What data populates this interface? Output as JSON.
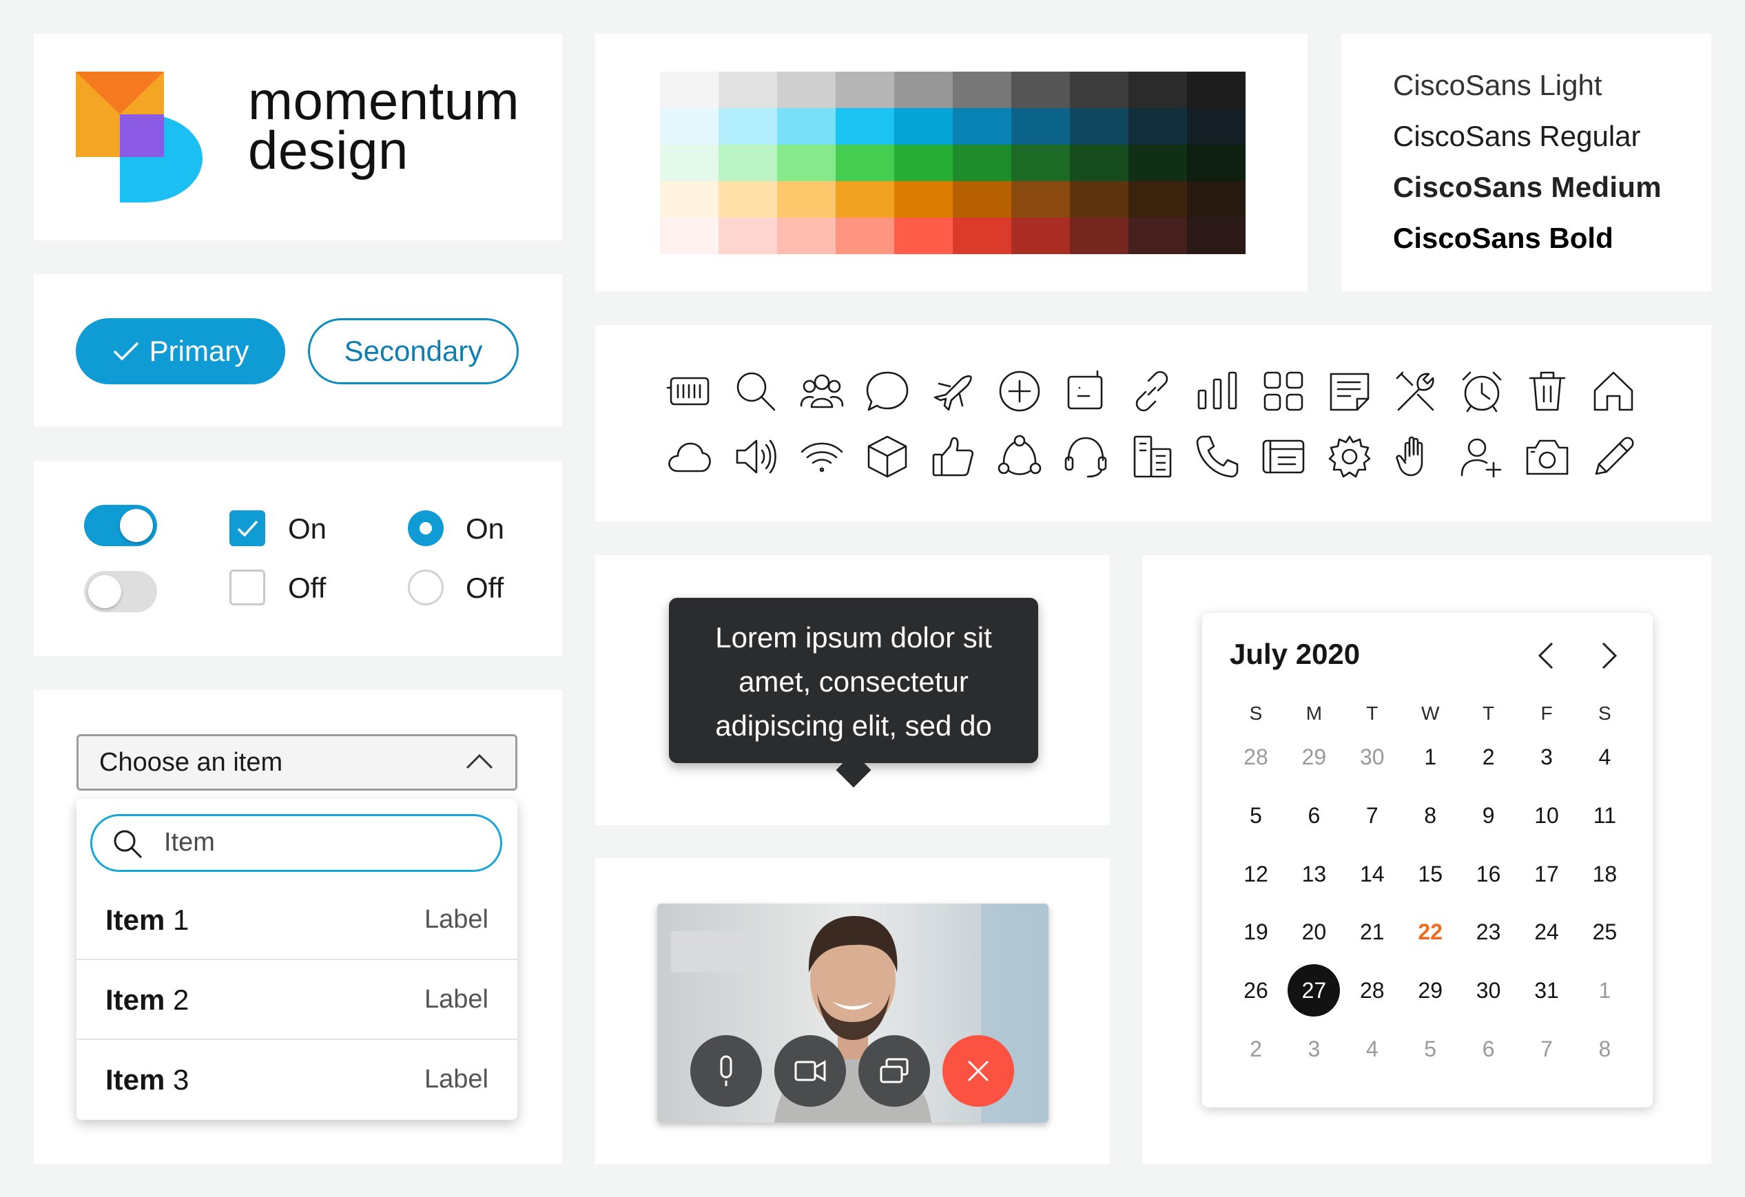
{
  "brand": {
    "line1": "momentum",
    "line2": "design"
  },
  "buttons": {
    "primary": "Primary",
    "secondary": "Secondary"
  },
  "controls": {
    "checkbox_on": "On",
    "checkbox_off": "Off",
    "radio_on": "On",
    "radio_off": "Off"
  },
  "palette": {
    "rows": [
      [
        "#f4f4f4",
        "#e2e2e2",
        "#cfcfcf",
        "#b5b5b5",
        "#979797",
        "#777777",
        "#555555",
        "#3c3c3c",
        "#2b2b2b",
        "#1c1c1c"
      ],
      [
        "#e4f8fd",
        "#b2eefc",
        "#79e0fa",
        "#1bc3f3",
        "#06a3d6",
        "#0882b2",
        "#0c6389",
        "#0f475f",
        "#112e3b",
        "#131f25"
      ],
      [
        "#e5f9ea",
        "#bbf5c6",
        "#86ea8d",
        "#45cd52",
        "#25ad34",
        "#1e8c2b",
        "#1c6a25",
        "#164b1d",
        "#102f14",
        "#0d1f10"
      ],
      [
        "#fff4e0",
        "#ffe1a9",
        "#fdc86b",
        "#f2a223",
        "#dd7e03",
        "#b66002",
        "#8a4a0f",
        "#5d330d",
        "#3a220c",
        "#251910"
      ],
      [
        "#fff2f0",
        "#ffd6cf",
        "#ffbdb0",
        "#ff9480",
        "#ff5c4a",
        "#db3b2b",
        "#a92d23",
        "#75261f",
        "#46201d",
        "#2b1918"
      ]
    ]
  },
  "fonts": [
    "CiscoSans Light",
    "CiscoSans Regular",
    "CiscoSans Medium",
    "CiscoSans Bold"
  ],
  "icons": {
    "row1": [
      "keyboard-icon",
      "search-icon",
      "people-icon",
      "chat-icon",
      "airplane-icon",
      "plus-circle-icon",
      "whiteboard-icon",
      "link-icon",
      "bar-chart-icon",
      "apps-icon",
      "notes-icon",
      "tools-icon",
      "alarm-icon",
      "trash-icon",
      "home-icon"
    ],
    "row2": [
      "cloud-icon",
      "speaker-icon",
      "wifi-icon",
      "cube-icon",
      "thumbs-up-icon",
      "share-icon",
      "headset-icon",
      "building-icon",
      "phone-icon",
      "calendar-panel-icon",
      "settings-icon",
      "raise-hand-icon",
      "add-user-icon",
      "camera-icon",
      "pencil-icon"
    ]
  },
  "dropdown": {
    "selected": "Choose an item",
    "search_placeholder": "Item",
    "items": [
      {
        "bold": "Item",
        "num": " 1",
        "label": "Label"
      },
      {
        "bold": "Item",
        "num": " 2",
        "label": "Label"
      },
      {
        "bold": "Item",
        "num": " 3",
        "label": "Label"
      }
    ]
  },
  "tooltip": {
    "lines": [
      "Lorem ipsum dolor sit",
      "amet, consectetur",
      "adipiscing elit, sed do"
    ]
  },
  "calendar": {
    "title": "July 2020",
    "dow": [
      "S",
      "M",
      "T",
      "W",
      "T",
      "F",
      "S"
    ],
    "weeks": [
      [
        "28",
        "29",
        "30",
        "1",
        "2",
        "3",
        "4"
      ],
      [
        "5",
        "6",
        "7",
        "8",
        "9",
        "10",
        "11"
      ],
      [
        "12",
        "13",
        "14",
        "15",
        "16",
        "17",
        "18"
      ],
      [
        "19",
        "20",
        "21",
        "22",
        "23",
        "24",
        "25"
      ],
      [
        "26",
        "27",
        "28",
        "29",
        "30",
        "31",
        "1"
      ],
      [
        "2",
        "3",
        "4",
        "5",
        "6",
        "7",
        "8"
      ]
    ],
    "today": "22",
    "selected": "27",
    "accent": "#f26b1d"
  },
  "colors": {
    "primary": "#0f9bd3",
    "danger": "#fc5242",
    "dark": "#2a2c2e"
  }
}
